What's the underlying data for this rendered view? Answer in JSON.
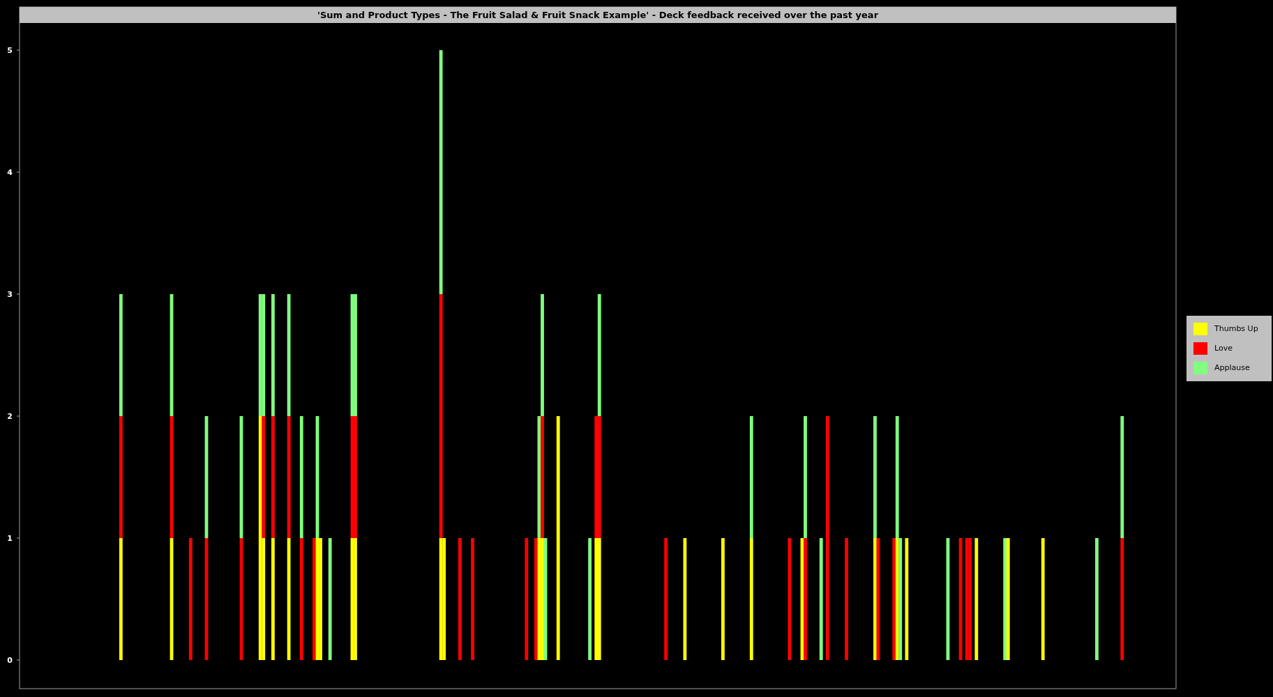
{
  "chart": {
    "title": "'Sum and Product Types - The Fruit Salad & Fruit Snack Example' - Deck feedback received over the past year",
    "y_axis_labels": [
      "5",
      "4",
      "3",
      "2",
      "1",
      "0"
    ]
  },
  "legend": [
    {
      "label": "Thumbs Up",
      "color": "#ffff00"
    },
    {
      "label": "Love",
      "color": "#ff0000"
    },
    {
      "label": "Applause",
      "color": "#80ff80"
    }
  ]
}
